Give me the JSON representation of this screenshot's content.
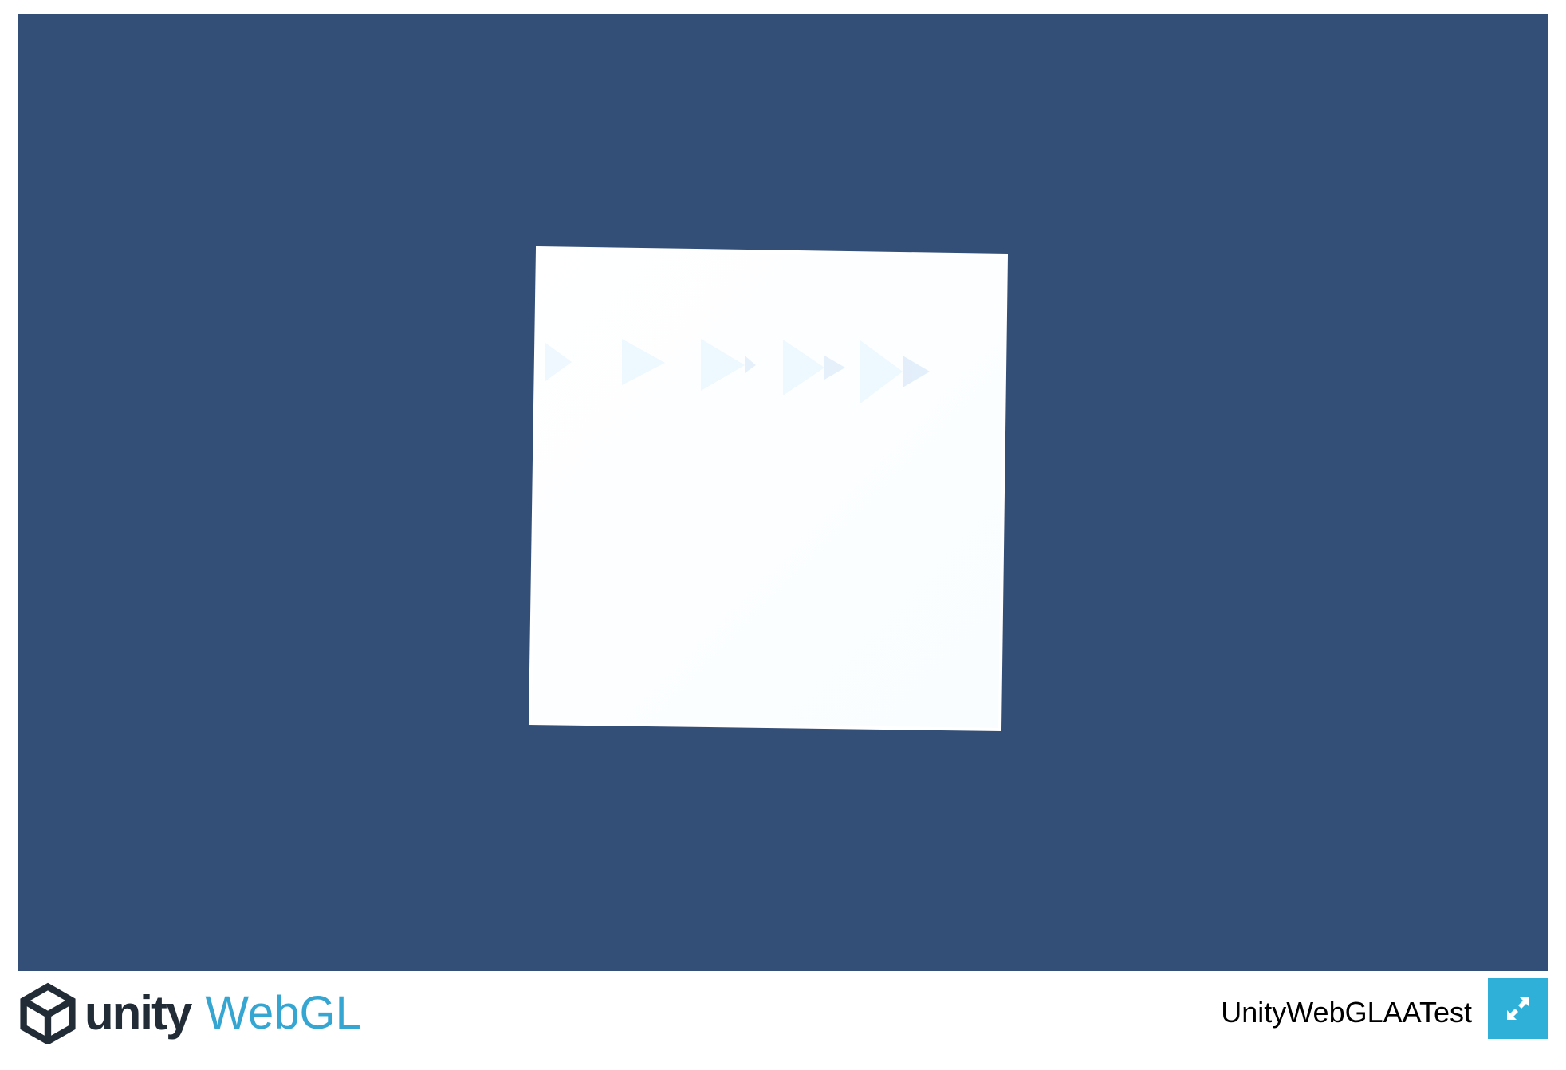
{
  "app": {
    "build_title": "UnityWebGLAATest",
    "logo": {
      "brand_text": "unity",
      "platform_text": "WebGL",
      "icon": "unity-cube-icon"
    },
    "fullscreen_button": {
      "icon": "fullscreen-expand-icon"
    }
  },
  "canvas": {
    "scene": "rotated-white-quad-with-faint-arrow-row",
    "arrow_count": 5
  },
  "colors": {
    "canvas_background": "#334f78",
    "quad_fill": "#fcffff",
    "brand_dark": "#222c37",
    "brand_blue": "#35a6d2",
    "fullscreen_button_bg": "#2fb0d8",
    "page_background": "#ffffff"
  }
}
